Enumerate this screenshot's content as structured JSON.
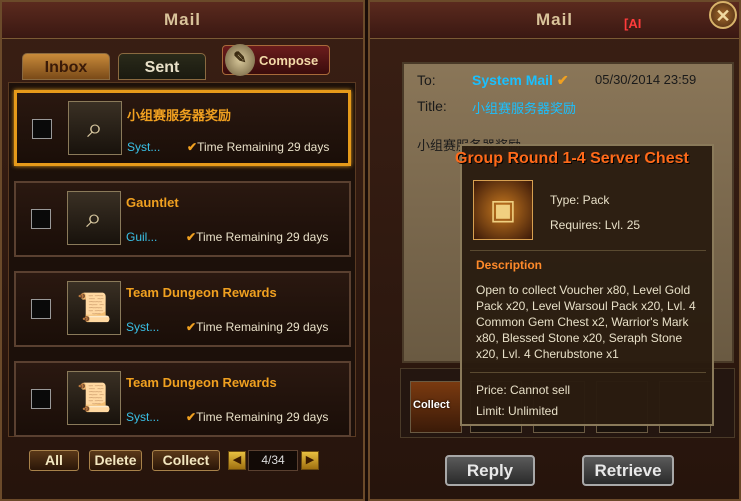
{
  "left_panel": {
    "title": "Mail",
    "tabs": [
      {
        "label": "Inbox",
        "active": true
      },
      {
        "label": "Sent",
        "active": false
      }
    ],
    "compose_label": "Compose",
    "mails": [
      {
        "subject": "小组赛服务器奖励",
        "sender": "Syst...",
        "remaining": "Time Remaining 29 days",
        "icon": "map-magnifier-icon",
        "selected": true
      },
      {
        "subject": "Gauntlet",
        "sender": "Guil...",
        "remaining": "Time Remaining 29 days",
        "icon": "map-magnifier-icon",
        "selected": false
      },
      {
        "subject": "Team Dungeon Rewards",
        "sender": "Syst...",
        "remaining": "Time Remaining 29 days",
        "icon": "scroll-icon",
        "selected": false
      },
      {
        "subject": "Team Dungeon Rewards",
        "sender": "Syst...",
        "remaining": "Time Remaining 29 days",
        "icon": "scroll-icon",
        "selected": false
      }
    ],
    "buttons": {
      "all": "All",
      "delete": "Delete",
      "collect": "Collect"
    },
    "pager": "4/34"
  },
  "right_panel": {
    "title": "Mail",
    "flag_text": "[AI",
    "to_label": "To:",
    "to_value": "System Mail",
    "date": "05/30/2014 23:59",
    "title_label": "Title:",
    "title_value": "小组赛服务器奖励",
    "body_text": "小组赛服务器奖励",
    "attachment_label": "Collect",
    "reply_label": "Reply",
    "retrieve_label": "Retrieve"
  },
  "tooltip": {
    "title": "Group Round 1-4 Server Chest",
    "type": "Type: Pack",
    "requires": "Requires: Lvl. 25",
    "description_header": "Description",
    "description": "Open to collect Voucher x80, Level Gold Pack x20, Level Warsoul Pack x20, Lvl. 4 Common Gem Chest x2, Warrior's Mark x80, Blessed Stone x20, Seraph Stone x20, Lvl. 4 Cherubstone x1",
    "price": "Price: Cannot sell",
    "limit": "Limit: Unlimited"
  },
  "colors": {
    "accent": "#e69a1a",
    "sender": "#39c0e6",
    "system_mail": "#1ac0ff",
    "tooltip_title": "#ff6a1a"
  }
}
